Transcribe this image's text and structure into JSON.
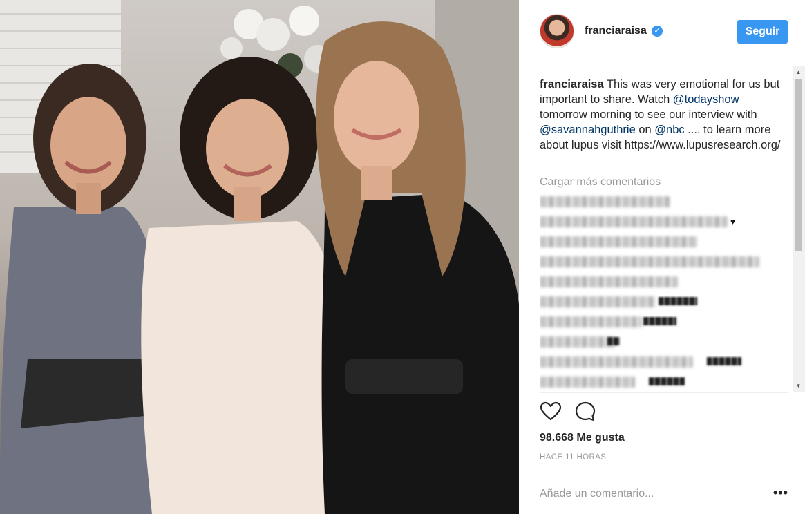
{
  "photo": {
    "alt": "Three women seated together, smiling"
  },
  "header": {
    "username": "franciaraisa",
    "verified_icon": "verified-badge-icon",
    "follow_label": "Seguir",
    "colors": {
      "accent": "#3897f0"
    }
  },
  "caption": {
    "username": "franciaraisa",
    "part1": " This was very emotional for us but important to share. Watch ",
    "mention1": "@todayshow",
    "part2": " tomorrow morning to see our interview with ",
    "mention2": "@savannahguthrie",
    "part3": " on ",
    "mention3": "@nbc",
    "part4": " .... to learn more about lupus visit https://www.lupusresearch.org/"
  },
  "comments": {
    "load_more": "Cargar más comentarios"
  },
  "actions": {
    "like_icon": "heart-icon",
    "comment_icon": "comment-icon",
    "likes": "98.668 Me gusta",
    "time": "HACE 11 HORAS"
  },
  "add_comment": {
    "placeholder": "Añade un comentario...",
    "more_label": "•••"
  }
}
